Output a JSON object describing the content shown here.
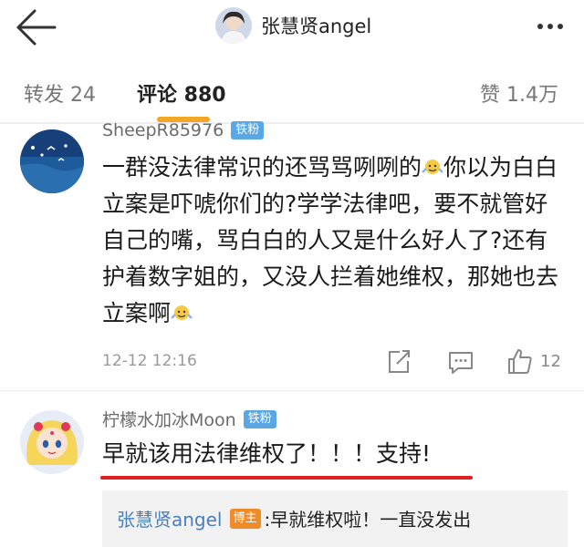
{
  "header": {
    "title": "张慧贤angel",
    "back_icon": "arrow-left-icon",
    "more_icon": "more-dots-icon"
  },
  "tabs": {
    "repost": "转发 24",
    "comments": "评论 880",
    "likes": "赞 1.4万",
    "active": "comments",
    "accent_color": "#f5a623"
  },
  "comments": [
    {
      "username": "SheepR85976",
      "badge": "铁粉",
      "text_parts": [
        "一群没法律常识的还骂骂咧咧的",
        "你以为白白立案是吓唬你们的?学学法律吧，要不就管好自己的嘴，骂白白的人又是什么好人了?还有护着数字姐的，又没人拦着她维权，那她也去立案啊"
      ],
      "time": "12-12 12:16",
      "like_count": "12"
    },
    {
      "username": "柠檬水加冰Moon",
      "badge": "铁粉",
      "text": "早就该用法律维权了！！！支持!",
      "highlight_color": "#e02020",
      "reply": {
        "author": "张慧贤angel",
        "author_badge": "博主",
        "text": ":早就维权啦！一直没发出"
      }
    }
  ]
}
